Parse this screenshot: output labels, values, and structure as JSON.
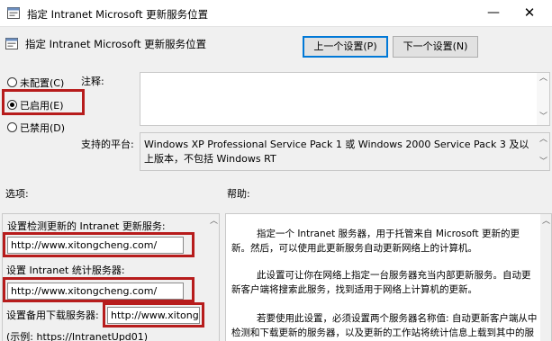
{
  "window": {
    "title": "指定 Intranet Microsoft 更新服务位置",
    "minimize_glyph": "—",
    "close_glyph": "✕"
  },
  "header": {
    "title": "指定 Intranet Microsoft 更新服务位置",
    "prev_button": "上一个设置(P)",
    "next_button": "下一个设置(N)"
  },
  "state": {
    "options": [
      {
        "label": "未配置(C)",
        "selected": false
      },
      {
        "label": "已启用(E)",
        "selected": true
      },
      {
        "label": "已禁用(D)",
        "selected": false
      }
    ],
    "comment_label": "注释:",
    "comment_value": "",
    "supported_label": "支持的平台:",
    "supported_value": "Windows XP Professional Service Pack 1 或 Windows 2000 Service Pack 3 及以上版本，不包括 Windows RT"
  },
  "options_section": {
    "heading": "选项:",
    "update_service_label": "设置检测更新的 Intranet 更新服务:",
    "update_service_value": "http://www.xitongcheng.com/",
    "stats_server_label": "设置 Intranet 统计服务器:",
    "stats_server_value": "http://www.xitongcheng.com/",
    "download_server_label": "设置备用下载服务器:",
    "download_server_value": "http://www.xitongch",
    "example_text": "(示例:   https://IntranetUpd01)"
  },
  "help_section": {
    "heading": "帮助:",
    "paragraphs": [
      "指定一个 Intranet 服务器，用于托管来自 Microsoft 更新的更新。然后，可以使用此更新服务自动更新网络上的计算机。",
      "此设置可让你在网络上指定一台服务器充当内部更新服务。自动更新客户端将搜索此服务，找到适用于网络上计算机的更新。",
      "若要使用此设置，必须设置两个服务器名称值: 自动更新客户端从中检测和下载更新的服务器，以及更新的工作站将统计信息上载到其中的服务器。"
    ]
  },
  "colors": {
    "highlight": "#b71c1c",
    "accent": "#0078d7"
  }
}
